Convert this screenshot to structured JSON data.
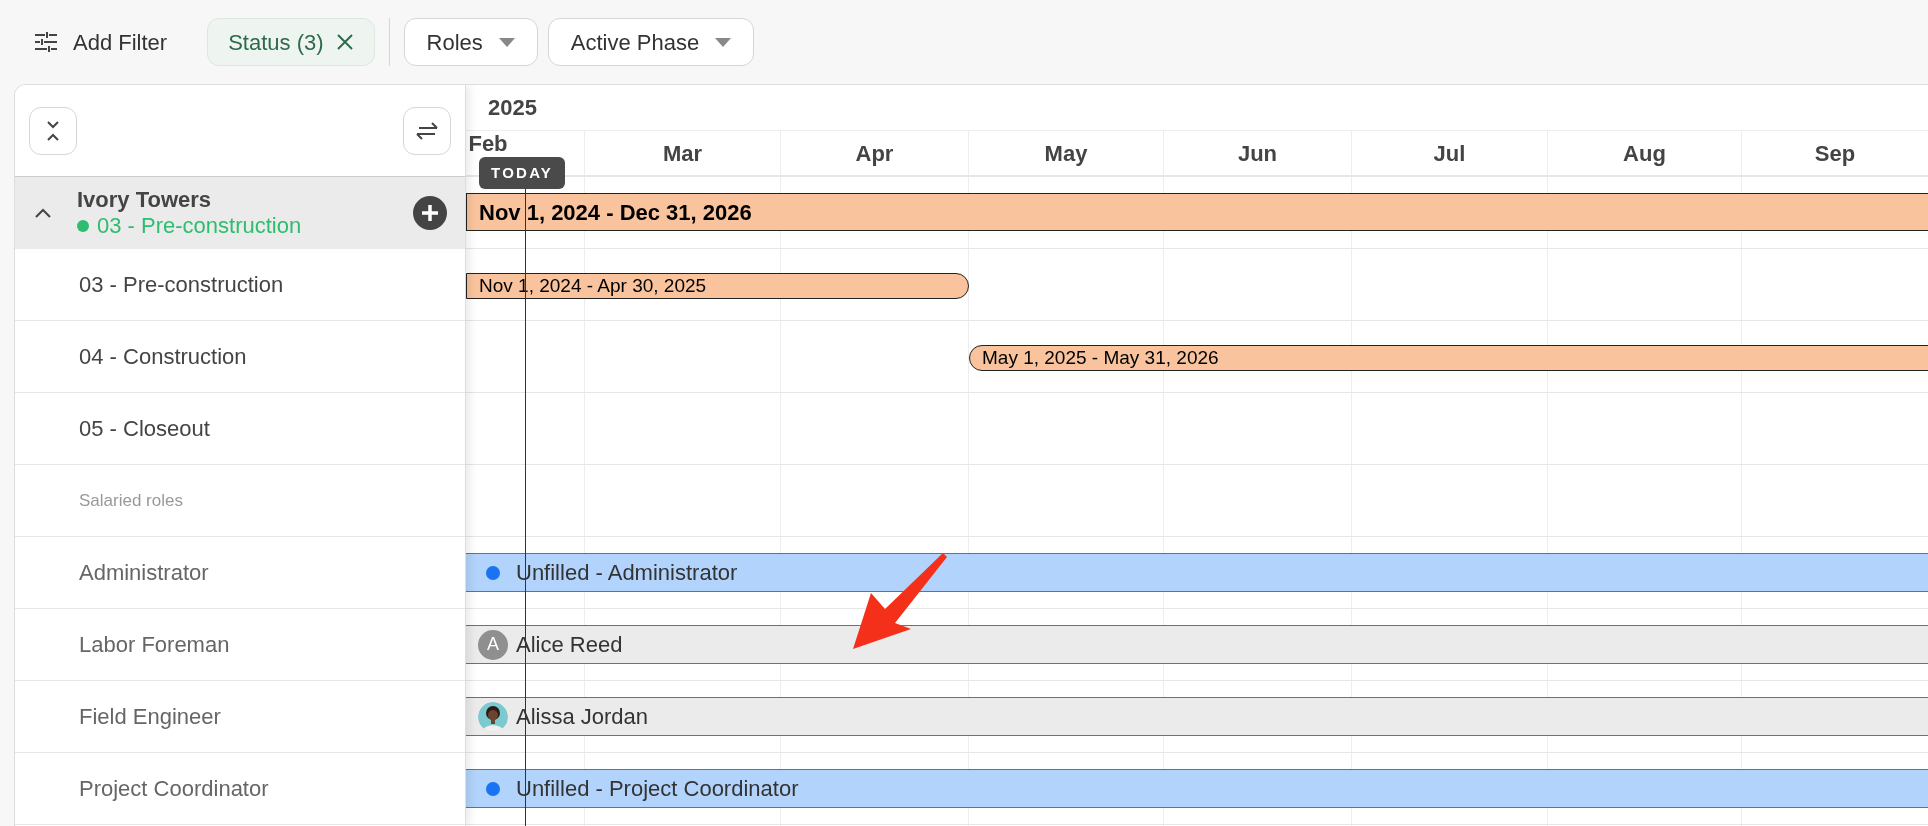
{
  "filters": {
    "add_label": "Add Filter",
    "chips": [
      {
        "label": "Status (3)",
        "kind": "active"
      },
      {
        "label": "Roles",
        "kind": "dropdown"
      },
      {
        "label": "Active Phase",
        "kind": "dropdown"
      }
    ]
  },
  "timeline": {
    "year": "2025",
    "months": [
      "Feb",
      "Mar",
      "Apr",
      "May",
      "Jun",
      "Jul",
      "Aug",
      "Sep"
    ],
    "today_label": "TODAY"
  },
  "project": {
    "name": "Ivory Towers",
    "status": "03 - Pre-construction",
    "expanded": true,
    "bar": "Nov 1, 2024 - Dec 31, 2026"
  },
  "phases": [
    {
      "label": "03 - Pre-construction",
      "bar": "Nov 1, 2024 - Apr 30, 2025"
    },
    {
      "label": "04 - Construction",
      "bar": "May 1, 2025 - May 31, 2026"
    },
    {
      "label": "05 - Closeout"
    }
  ],
  "section": "Salaried roles",
  "roles": [
    {
      "label": "Administrator",
      "kind": "unfilled",
      "assignee": "Unfilled - Administrator"
    },
    {
      "label": "Labor Foreman",
      "kind": "initial",
      "initial": "A",
      "assignee": "Alice Reed"
    },
    {
      "label": "Field Engineer",
      "assignee": "Alissa Jordan"
    },
    {
      "label": "Project Coordinator",
      "kind": "unfilled",
      "assignee": "Unfilled - Project Coordinator"
    }
  ]
}
